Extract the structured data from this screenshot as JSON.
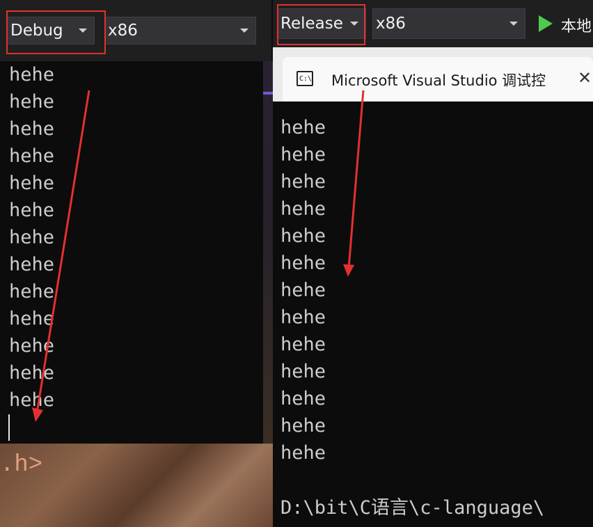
{
  "debug_panel": {
    "configuration": "Debug",
    "platform": "x86",
    "output_lines": [
      "hehe",
      "hehe",
      "hehe",
      "hehe",
      "hehe",
      "hehe",
      "hehe",
      "hehe",
      "hehe",
      "hehe",
      "hehe",
      "hehe",
      "hehe"
    ],
    "background_text": ".h>"
  },
  "release_panel": {
    "configuration": "Release",
    "platform": "x86",
    "run_label": "本地",
    "terminal": {
      "tab_title": "Microsoft Visual Studio 调试控",
      "tab_icon_text": "C:\\",
      "close_symbol": "✕",
      "output_lines": [
        "hehe",
        "hehe",
        "hehe",
        "hehe",
        "hehe",
        "hehe",
        "hehe",
        "hehe",
        "hehe",
        "hehe",
        "hehe",
        "hehe",
        "hehe"
      ],
      "path_text": "D:\\bit\\C语言\\c-language\\"
    }
  },
  "colors": {
    "highlight_box": "#e2312f",
    "arrow": "#e2312f",
    "console_text": "#cccccc",
    "run_icon": "#4ec94e"
  },
  "icons": [
    "play-icon",
    "terminal-icon",
    "close-icon",
    "dropdown-caret-icon"
  ]
}
